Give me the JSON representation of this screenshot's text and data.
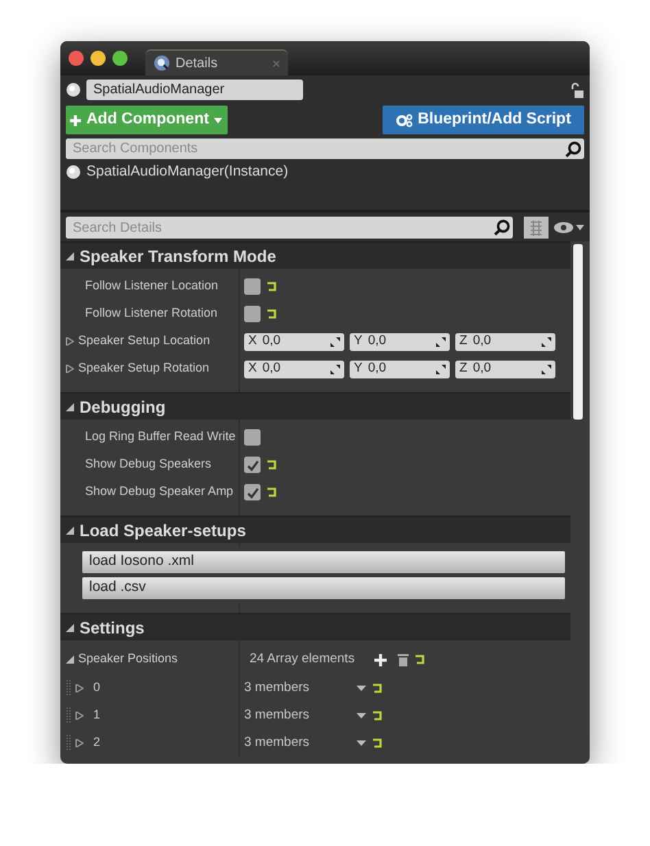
{
  "window": {
    "tab": "Details"
  },
  "actor": {
    "name": "SpatialAudioManager"
  },
  "buttons": [
    {
      "kind": "add",
      "label": "Add Component"
    },
    {
      "kind": "blueprint",
      "label": "Blueprint/Add Script"
    }
  ],
  "component_search": {
    "placeholder": "Search Components"
  },
  "components": [
    {
      "label": "SpatialAudioManager(Instance)"
    }
  ],
  "details_search": {
    "placeholder": "Search Details"
  },
  "sections": [
    {
      "title": "Speaker Transform Mode",
      "expanded": true,
      "rows": [
        {
          "kind": "checkbox",
          "label": "Follow Listener Location",
          "checked": false,
          "reset": true
        },
        {
          "kind": "checkbox",
          "label": "Follow Listener Rotation",
          "checked": false,
          "reset": true
        },
        {
          "kind": "vector",
          "label": "Speaker Setup Location",
          "expanded": false,
          "fields": [
            {
              "axis": "X",
              "value": "0,0"
            },
            {
              "axis": "Y",
              "value": "0,0"
            },
            {
              "axis": "Z",
              "value": "0,0"
            }
          ]
        },
        {
          "kind": "vector",
          "label": "Speaker Setup Rotation",
          "expanded": false,
          "fields": [
            {
              "axis": "X",
              "value": "0,0"
            },
            {
              "axis": "Y",
              "value": "0,0"
            },
            {
              "axis": "Z",
              "value": "0,0"
            }
          ]
        }
      ]
    },
    {
      "title": "Debugging",
      "expanded": true,
      "rows": [
        {
          "kind": "checkbox",
          "label": "Log Ring Buffer Read Write",
          "checked": false,
          "reset": false
        },
        {
          "kind": "checkbox",
          "label": "Show Debug Speakers",
          "checked": true,
          "reset": true
        },
        {
          "kind": "checkbox",
          "label": "Show Debug Speaker Amp",
          "checked": true,
          "reset": true
        }
      ]
    },
    {
      "title": "Load Speaker-setups",
      "expanded": true,
      "rows": [
        {
          "kind": "button",
          "label": "load Iosono .xml"
        },
        {
          "kind": "button",
          "label": "load .csv"
        }
      ]
    },
    {
      "title": "Settings",
      "expanded": true,
      "rows": [
        {
          "kind": "array",
          "label": "Speaker Positions",
          "expanded": true,
          "value": "24 Array elements"
        },
        {
          "kind": "item",
          "label": "0",
          "expanded": false,
          "value": "3 members"
        },
        {
          "kind": "item",
          "label": "1",
          "expanded": false,
          "value": "3 members"
        },
        {
          "kind": "item",
          "label": "2",
          "expanded": false,
          "value": "3 members"
        }
      ]
    }
  ]
}
